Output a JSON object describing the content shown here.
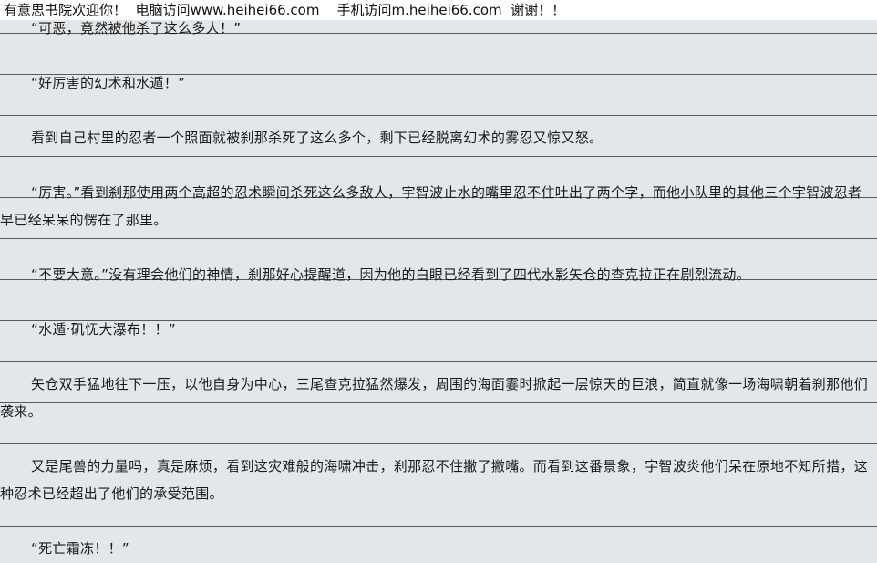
{
  "banner": {
    "site": "有意思书院欢迎你！",
    "pc": "电脑访问www.heihei66.com",
    "mobile": "手机访问m.heihei66.com",
    "thanks": "谢谢！！"
  },
  "paragraphs": [
    "“可恶，竟然被他杀了这么多人！”",
    "“好厉害的幻术和水遁！”",
    "看到自己村里的忍者一个照面就被刹那杀死了这么多个，剩下已经脱离幻术的雾忍又惊又怒。",
    "“厉害。”看到刹那使用两个高超的忍术瞬间杀死这么多敌人，宇智波止水的嘴里忍不住吐出了两个字，而他小队里的其他三个宇智波忍者早已经呆呆的愣在了那里。",
    "“不要大意。”没有理会他们的神情，刹那好心提醒道，因为他的白眼已经看到了四代水影矢仓的查克拉正在剧烈流动。",
    "“水遁·矶怃大瀑布！！”",
    "矢仓双手猛地往下一压，以他自身为中心，三尾查克拉猛然爆发，周围的海面霎时掀起一层惊天的巨浪，简直就像一场海啸朝着刹那他们袭来。",
    "又是尾兽的力量吗，真是麻烦，看到这灾难般的海啸冲击，刹那忍不住撇了撇嘴。而看到这番景象，宇智波炎他们呆在原地不知所措，这种忍术已经超出了他们的承受范围。",
    "“死亡霜冻！！”"
  ]
}
